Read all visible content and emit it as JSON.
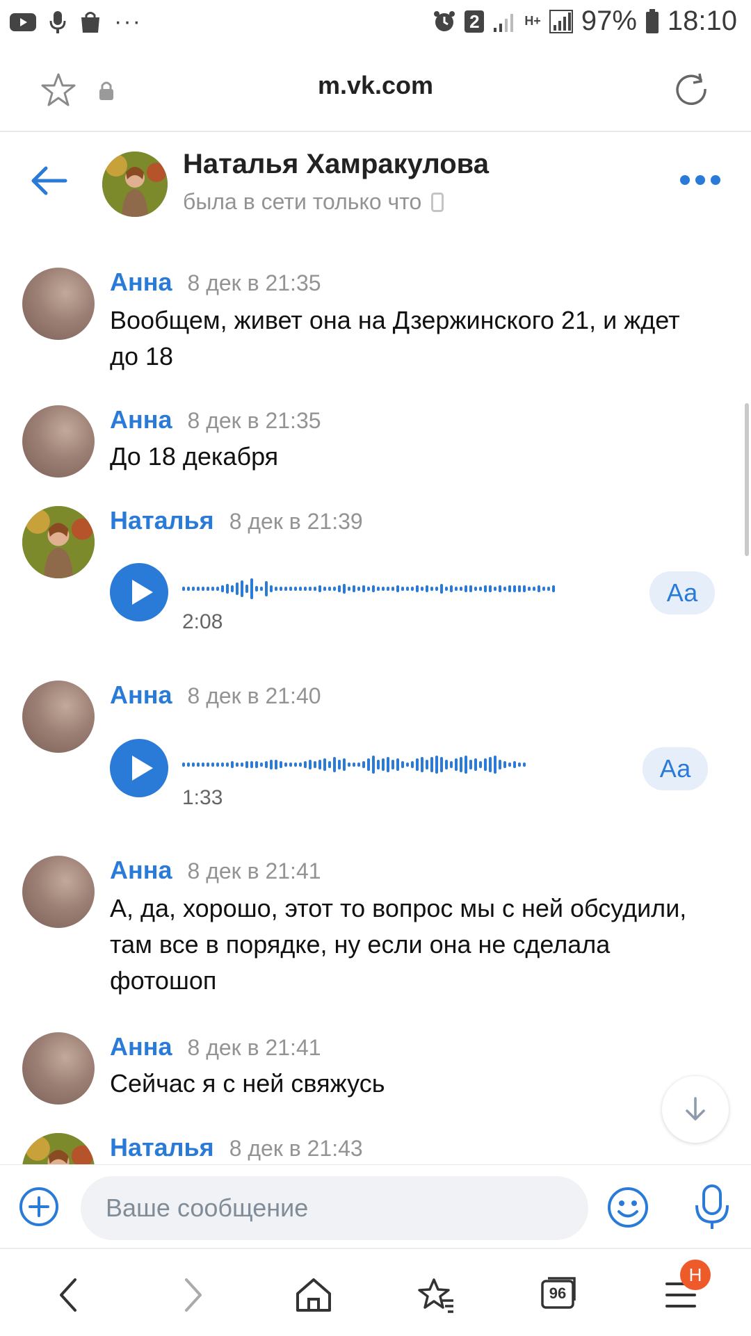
{
  "status_bar": {
    "battery_percent": "97%",
    "time": "18:10",
    "notification_count": "2",
    "network": "H+",
    "more": "···"
  },
  "browser": {
    "url": "m.vk.com",
    "tabs_count": "96",
    "menu_badge": "Н"
  },
  "chat": {
    "contact_name": "Наталья Хамракулова",
    "contact_status": "была в сети только что"
  },
  "messages": [
    {
      "author": "Анна",
      "time": "8 дек в 21:35",
      "text": "Вообщем, живет она на Дзержинского 21, и ждет до 18"
    },
    {
      "author": "Анна",
      "time": "8 дек в 21:35",
      "text": "До 18 декабря"
    },
    {
      "author": "Наталья",
      "time": "8 дек в 21:39",
      "voice_duration": "2:08",
      "transcribe_label": "Аа"
    },
    {
      "author": "Анна",
      "time": "8 дек в 21:40",
      "voice_duration": "1:33",
      "transcribe_label": "Аа"
    },
    {
      "author": "Анна",
      "time": "8 дек в 21:41",
      "text": "А, да, хорошо, этот то вопрос мы с ней обсудили, там все в порядке, ну если она не сделала фотошоп"
    },
    {
      "author": "Анна",
      "time": "8 дек в 21:41",
      "text": "Сейчас я с ней свяжусь"
    },
    {
      "author": "Наталья",
      "time": "8 дек в 21:43"
    }
  ],
  "composer": {
    "placeholder": "Ваше сообщение"
  },
  "colors": {
    "accent": "#2a7ad8",
    "meta_text": "#939393",
    "input_bg": "#f0f2f5",
    "badge": "#ee5a2a"
  }
}
